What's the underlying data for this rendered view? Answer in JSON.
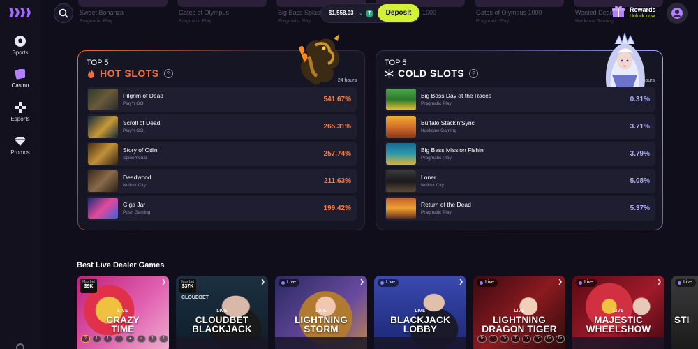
{
  "sidebar": {
    "items": [
      {
        "label": "Sports",
        "icon": "soccer-ball-icon"
      },
      {
        "label": "Casino",
        "icon": "cards-icon",
        "active": true
      },
      {
        "label": "Esports",
        "icon": "gamepad-icon"
      },
      {
        "label": "Promos",
        "icon": "diamond-icon"
      }
    ]
  },
  "topbar": {
    "ghost_games": [
      {
        "name": "Sweet Bonanza",
        "provider": "Pragmatic Play"
      },
      {
        "name": "Gates of Olympus",
        "provider": "Pragmatic Play"
      },
      {
        "name": "Big Bass Splash",
        "provider": "Pragmatic Play"
      },
      {
        "name": "1000",
        "provider": ""
      },
      {
        "name": "Gates of Olympus 1000",
        "provider": "Pragmatic Play"
      },
      {
        "name": "Wanted Dead",
        "provider": "Hacksaw Gaming"
      }
    ],
    "balance": "$1,558.03",
    "currency_icon": "T",
    "deposit_label": "Deposit",
    "rewards_title": "Rewards",
    "rewards_sub": "Unlock now"
  },
  "hot": {
    "top": "TOP 5",
    "title": "HOT SLOTS",
    "period": "24 hours",
    "accent": "#ff6b2d",
    "games": [
      {
        "name": "Pilgrim of Dead",
        "provider": "Play'n GO",
        "value": "541.67%"
      },
      {
        "name": "Scroll of Dead",
        "provider": "Play'n GO",
        "value": "265.31%"
      },
      {
        "name": "Story of Odin",
        "provider": "Spinomenal",
        "value": "257.74%"
      },
      {
        "name": "Deadwood",
        "provider": "Nolimit City",
        "value": "211.63%"
      },
      {
        "name": "Giga Jar",
        "provider": "Push Gaming",
        "value": "199.42%"
      }
    ]
  },
  "cold": {
    "top": "TOP 5",
    "title": "COLD SLOTS",
    "period": "24 hours",
    "accent": "#a8b0ff",
    "games": [
      {
        "name": "Big Bass Day at the Races",
        "provider": "Pragmatic Play",
        "value": "0.31%"
      },
      {
        "name": "Buffalo Stack'n'Sync",
        "provider": "Hacksaw Gaming",
        "value": "3.71%"
      },
      {
        "name": "Big Bass Mission Fishin'",
        "provider": "Pragmatic Play",
        "value": "3.79%"
      },
      {
        "name": "Loner",
        "provider": "Nolimit City",
        "value": "5.08%"
      },
      {
        "name": "Return of the Dead",
        "provider": "Pragmatic Play",
        "value": "5.37%"
      }
    ]
  },
  "live": {
    "title": "Best Live Dealer Games",
    "cards": [
      {
        "tag_top": "Max bet",
        "tag_val": "$9K",
        "small": "LIVE",
        "t1": "CRAZY",
        "t2": "TIME"
      },
      {
        "tag_top": "Max bet",
        "tag_val": "$37K",
        "brand": "CLOUDBET",
        "small": "LIVE",
        "t1": "CLOUDBET",
        "t2": "BLACKJACK"
      },
      {
        "pill": "Live",
        "small": "LIVE",
        "t1": "LIGHTNING",
        "t2": "STORM"
      },
      {
        "pill": "Live",
        "small": "LIVE",
        "t1": "BLACKJACK",
        "t2": "LOBBY"
      },
      {
        "pill": "Live",
        "small": "LIVE",
        "t1": "LIGHTNING",
        "t2": "DRAGON TIGER"
      },
      {
        "pill": "Live",
        "small": "LIVE",
        "t1": "MAJESTIC",
        "t2": "WHEELSHOW"
      },
      {
        "pill": "Live",
        "t1": "STI",
        "t2": ""
      }
    ]
  }
}
